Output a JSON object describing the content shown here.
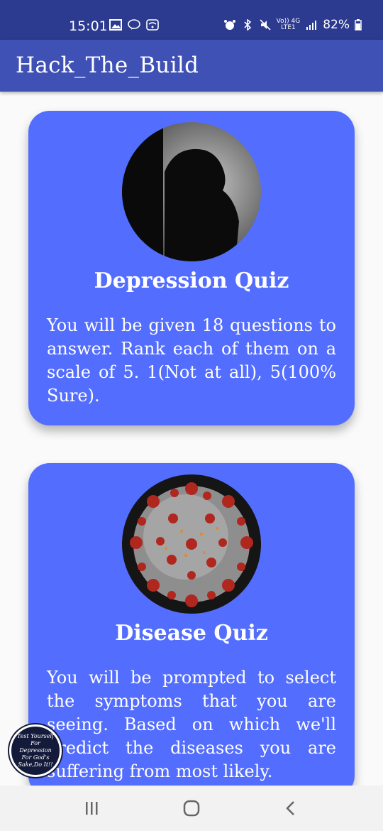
{
  "status_bar": {
    "time": "15:01",
    "network_line1": "Vo)) 4G",
    "network_line2": "LTE1",
    "battery": "82%"
  },
  "app_bar": {
    "title": "Hack_The_Build"
  },
  "cards": [
    {
      "title": "Depression Quiz",
      "description": "You will be given 18 questions to answer. Rank each of them on a scale of 5. 1(Not at all), 5(100% Sure).",
      "image": "depression-silhouette-image"
    },
    {
      "title": "Disease Quiz",
      "description": "You will be prompted to select the symptoms that you are seeing. Based on which we'll predict the diseases you are suffering from most likely.",
      "image": "coronavirus-image"
    }
  ],
  "fab": {
    "text": "Test Yourself For Depression For God's Sake,Do It!!"
  },
  "colors": {
    "status_bar": "#2c3a8f",
    "app_bar": "#3f51b5",
    "card": "#536dfe"
  }
}
